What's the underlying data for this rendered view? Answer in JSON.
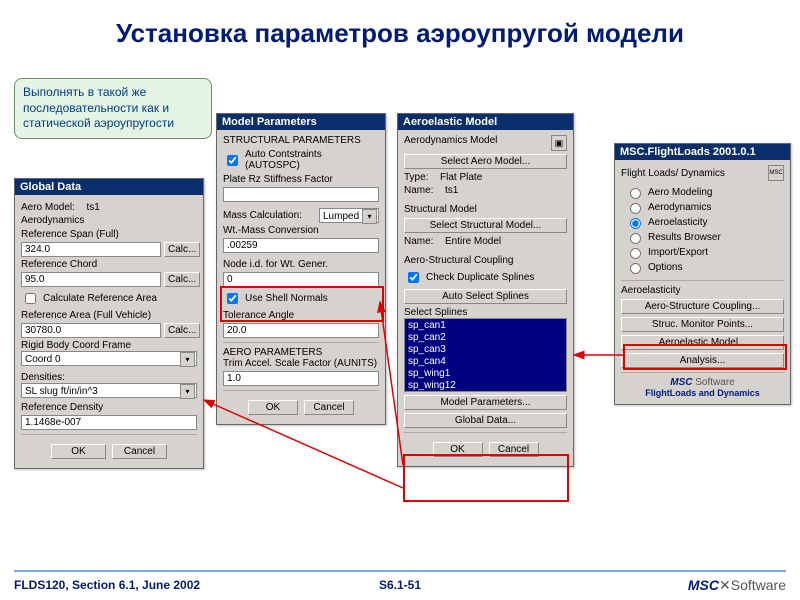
{
  "title": "Установка параметров аэроупругой модели",
  "note": "Выполнять в такой же последовательности как и статической аэроупругости",
  "global": {
    "title": "Global Data",
    "aero_model_label": "Aero Model:",
    "aero_model": "ts1",
    "grp": "Aerodynamics",
    "ref_span_lbl": "Reference Span (Full)",
    "ref_span": "324.0",
    "ref_chord_lbl": "Reference Chord",
    "ref_chord": "95.0",
    "calc_area": "Calculate Reference Area",
    "ref_area_lbl": "Reference Area (Full Vehicle)",
    "ref_area": "30780.0",
    "rbcf_lbl": "Rigid Body Coord Frame",
    "rbcf": "Coord 0",
    "dens_lbl": "Densities:",
    "dens": "SL slug ft/in/in^3",
    "refdens_lbl": "Reference Density",
    "refdens": "1.1468e-007",
    "calc": "Calc...",
    "ok": "OK",
    "cancel": "Cancel"
  },
  "mp": {
    "title": "Model Parameters",
    "sp": "STRUCTURAL PARAMETERS",
    "autospc": "Auto Contstraints (AUTOSPC)",
    "rz": "Plate Rz Stiffness Factor",
    "rz_v": "",
    "mass": "Mass Calculation:",
    "mass_v": "Lumped",
    "wt": "Wt.-Mass Conversion",
    "wt_v": ".00259",
    "node": "Node i.d. for Wt. Gener.",
    "node_v": "0",
    "shell": "Use Shell Normals",
    "tol": "Tolerance Angle",
    "tol_v": "20.0",
    "ap": "AERO PARAMETERS",
    "tsf": "Trim Accel. Scale Factor (AUNITS)",
    "tsf_v": "1.0",
    "ok": "OK",
    "cancel": "Cancel"
  },
  "ae": {
    "title": "Aeroelastic Model",
    "adm": "Aerodynamics Model",
    "sel_aero": "Select Aero Model...",
    "type_lbl": "Type:",
    "type": "Flat Plate",
    "name_lbl": "Name:",
    "name": "ts1",
    "sm": "Structural Model",
    "sel_struct": "Select Structural Model...",
    "sm_name_lbl": "Name:",
    "sm_name": "Entire Model",
    "asc": "Aero-Structural Coupling",
    "cds": "Check Duplicate Splines",
    "auto_sel": "Auto Select Splines",
    "ss": "Select Splines",
    "splines": [
      "sp_can1",
      "sp_can2",
      "sp_can3",
      "sp_can4",
      "sp_wing1",
      "sp_wing12"
    ],
    "mp": "Model Parameters...",
    "gd": "Global Data...",
    "ok": "OK",
    "cancel": "Cancel"
  },
  "fl": {
    "title": "MSC.FlightLoads 2001.0.1",
    "hdr": "Flight Loads/ Dynamics",
    "opts": [
      "Aero Modeling",
      "Aerodynamics",
      "Aeroelasticity",
      "Results Browser",
      "Import/Export",
      "Options"
    ],
    "sel": 2,
    "grp": "Aeroelasticity",
    "b1": "Aero-Structure Coupling...",
    "b2": "Struc. Monitor Points...",
    "b3": "Aeroelastic Model...",
    "b4": "Analysis...",
    "logo1": "MSC Software",
    "logo2": "FlightLoads and Dynamics"
  },
  "footer": {
    "l": "FLDS120, Section 6.1, June 2002",
    "c": "S6.1-51",
    "r_brand": "MSC",
    "r_prod": "Software"
  }
}
